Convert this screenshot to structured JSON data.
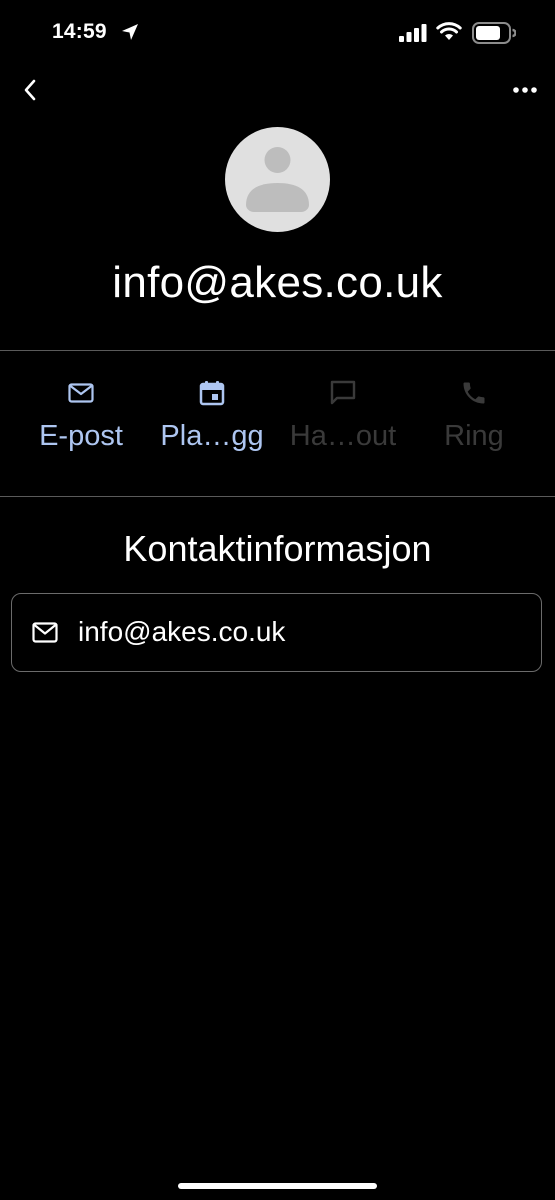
{
  "status_bar": {
    "time": "14:59",
    "icons": [
      "location-arrow-icon",
      "cellular-signal-icon",
      "wifi-icon",
      "battery-icon"
    ]
  },
  "header": {
    "back_icon": "chevron-left-icon",
    "more_icon": "more-horizontal-icon"
  },
  "contact": {
    "name": "info@akes.co.uk",
    "avatar_icon": "person-placeholder-icon"
  },
  "actions": [
    {
      "label": "E-post",
      "icon": "mail-icon",
      "enabled": true
    },
    {
      "label": "Pla…gg",
      "icon": "calendar-icon",
      "enabled": true
    },
    {
      "label": "Ha…out",
      "icon": "chat-icon",
      "enabled": false
    },
    {
      "label": "Ring",
      "icon": "phone-icon",
      "enabled": false
    }
  ],
  "contact_info": {
    "title": "Kontaktinformasjon",
    "items": [
      {
        "icon": "mail-icon",
        "value": "info@akes.co.uk"
      }
    ]
  },
  "colors": {
    "background": "#000000",
    "accent": "#aec6f1",
    "disabled": "#3a3a3a",
    "divider": "#5a5a5a"
  }
}
